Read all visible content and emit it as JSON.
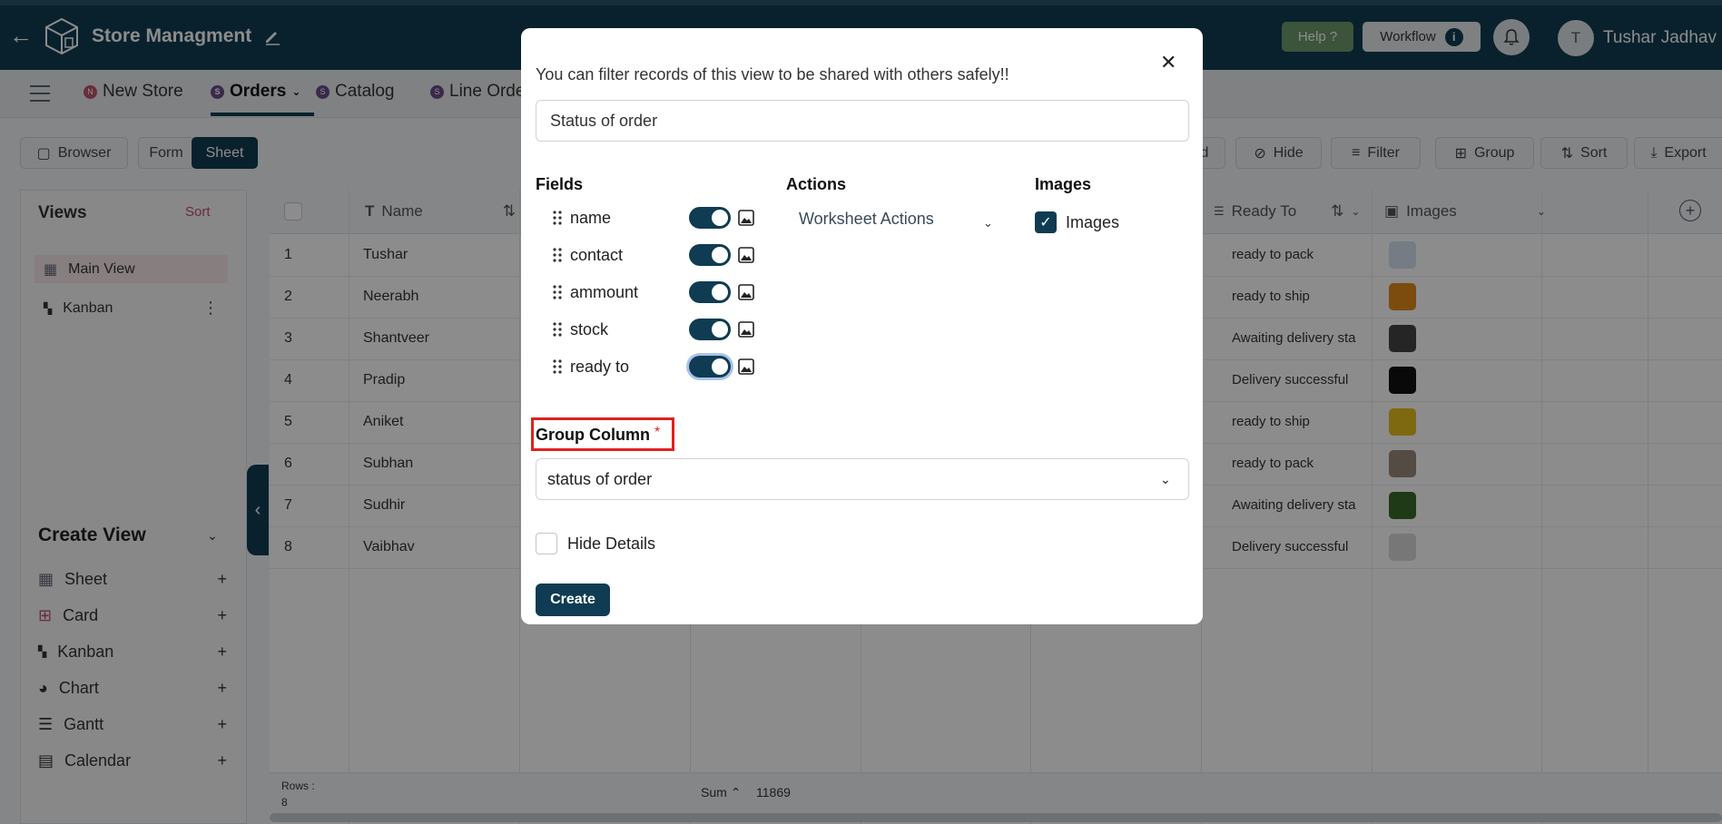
{
  "header": {
    "app_title": "Store Managment",
    "help_label": "Help ?",
    "workflow_label": "Workflow",
    "workflow_info": "i",
    "avatar_initial": "T",
    "user_name": "Tushar Jadhav"
  },
  "tabs": [
    {
      "label": "New Store",
      "dot": "N",
      "dot_color": "#c0506a"
    },
    {
      "label": "Orders",
      "dot": "S",
      "dot_color": "#6b4c8a"
    },
    {
      "label": "Catalog",
      "dot": "S",
      "dot_color": "#6b4c8a"
    },
    {
      "label": "Line Orde",
      "dot": "S",
      "dot_color": "#6b4c8a"
    }
  ],
  "toolbar": {
    "browser": "Browser",
    "form": "Form",
    "sheet": "Sheet",
    "add_partial": "d",
    "hide": "Hide",
    "filter": "Filter",
    "group": "Group",
    "sort": "Sort",
    "export": "Export"
  },
  "sidebar": {
    "views_title": "Views",
    "views_sort": "Sort",
    "views": [
      "Main View",
      "Kanban"
    ],
    "create_view_title": "Create View",
    "create_items": [
      "Sheet",
      "Card",
      "Kanban",
      "Chart",
      "Gantt",
      "Calendar"
    ]
  },
  "grid": {
    "columns": {
      "name": "Name",
      "ready_to": "Ready To",
      "images": "Images"
    },
    "rows": [
      {
        "num": "1",
        "name": "Tushar",
        "ready": "ready to pack",
        "img_color": "#d8e2f0"
      },
      {
        "num": "2",
        "name": "Neerabh",
        "ready": "ready to ship",
        "img_color": "#e08a1a"
      },
      {
        "num": "3",
        "name": "Shantveer",
        "ready": "Awaiting delivery sta",
        "img_color": "#444444"
      },
      {
        "num": "4",
        "name": "Pradip",
        "ready": "Delivery successful",
        "img_color": "#111111"
      },
      {
        "num": "5",
        "name": "Aniket",
        "ready": "ready to ship",
        "img_color": "#e6c020"
      },
      {
        "num": "6",
        "name": "Subhan",
        "ready": "ready to pack",
        "img_color": "#9a8a7a"
      },
      {
        "num": "7",
        "name": "Sudhir",
        "ready": "Awaiting delivery sta",
        "img_color": "#3a6a2a"
      },
      {
        "num": "8",
        "name": "Vaibhav",
        "ready": "Delivery successful",
        "img_color": "#d9d9d9"
      }
    ],
    "footer": {
      "rows_label": "Rows :",
      "rows_count": "8",
      "sum_label": "Sum",
      "sum_value": "11869"
    }
  },
  "modal": {
    "description": "You can filter records of this view to be shared with others safely!!",
    "name_value": "Status of order",
    "fields_title": "Fields",
    "actions_title": "Actions",
    "images_title": "Images",
    "fields": [
      "name",
      "contact",
      "ammount",
      "stock",
      "ready to"
    ],
    "actions_value": "Worksheet Actions",
    "images_checkbox_label": "Images",
    "group_column_label": "Group Column",
    "required_mark": "*",
    "group_column_value": "status of order",
    "hide_details_label": "Hide Details",
    "create_label": "Create"
  },
  "colors": {
    "primary": "#0f3c52",
    "highlight_border": "#e02020",
    "help_green": "#6c9a6b"
  }
}
